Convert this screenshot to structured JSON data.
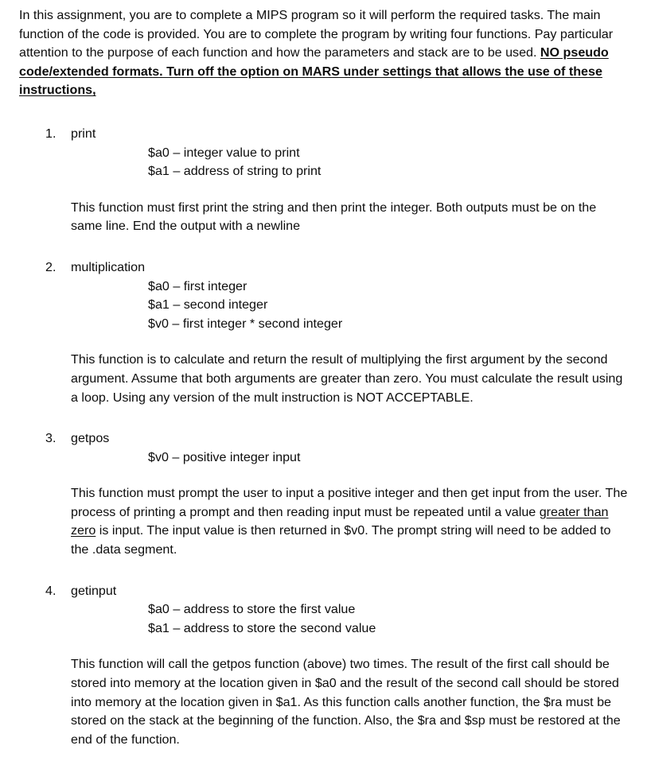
{
  "document": {
    "intro": {
      "text_before_emphasis": "In this assignment, you are to complete a MIPS program so it will perform the required tasks.  The main function of the code is provided.  You are to complete the program by writing four functions.  Pay particular attention to the purpose of each function and how the parameters and stack are to be used.  ",
      "emphasized_text": "NO pseudo code/extended formats.  Turn off the option on MARS under settings that allows the use of these instructions,"
    },
    "functions": [
      {
        "marker": "1.",
        "name": "print",
        "registers": [
          "$a0 – integer value to print",
          "$a1 – address of string to print"
        ],
        "description_parts": {
          "before": "This function must first print the string and then print the integer.  Both outputs must be on the same line.  End the output with a newline",
          "underlined": "",
          "after": ""
        }
      },
      {
        "marker": "2.",
        "name": "multiplication",
        "registers": [
          "$a0 – first integer",
          "$a1 – second integer",
          "$v0 – first integer * second integer"
        ],
        "description_parts": {
          "before": "This function is to calculate and return the result of multiplying the first argument by the second argument.  Assume that both arguments are greater than zero.  You must calculate the result using a loop. Using any version of the mult instruction is NOT ACCEPTABLE.",
          "underlined": "",
          "after": ""
        }
      },
      {
        "marker": "3.",
        "name": "getpos",
        "registers": [
          "$v0 – positive integer input"
        ],
        "description_parts": {
          "before": "This function must prompt the user to input a positive integer and then get input from the user.  The process of printing a prompt and then reading input must be repeated until a value ",
          "underlined": "greater than zero",
          "after": " is input.  The input value is then returned in $v0.  The prompt string will need to be added to the .data segment."
        }
      },
      {
        "marker": "4.",
        "name": "getinput",
        "registers": [
          "$a0 – address to store the first value",
          "$a1 – address to store the second value"
        ],
        "description_parts": {
          "before": "This function will call the getpos function (above) two times.  The result of the first call should be stored into memory at the location given in $a0 and the result of the second call should be stored into memory at the location given in $a1.  As this function calls another function, the $ra must be stored on the stack at the beginning of the function.  Also, the $ra and $sp must be restored at the end of the function.",
          "underlined": "",
          "after": ""
        }
      }
    ]
  }
}
